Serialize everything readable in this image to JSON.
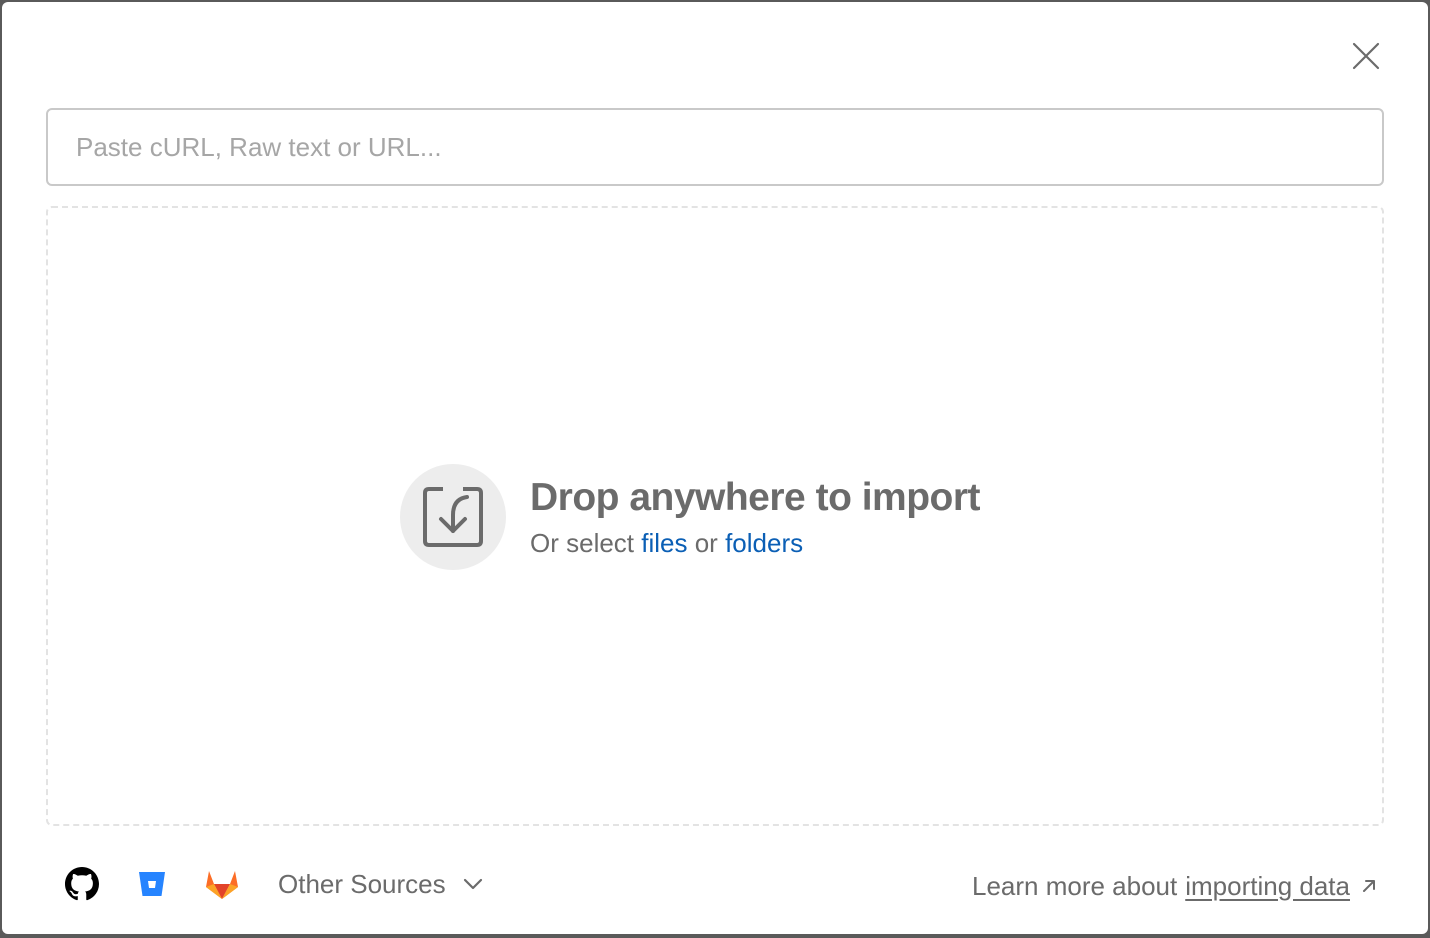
{
  "dialog": {
    "close_label": "Close"
  },
  "url_input": {
    "placeholder": "Paste cURL, Raw text or URL...",
    "value": ""
  },
  "dropzone": {
    "title": "Drop anywhere to import",
    "subtitle_prefix": "Or select ",
    "files_link": "files",
    "middle": " or ",
    "folders_link": "folders",
    "icon": "import-icon"
  },
  "sources": {
    "icons": [
      "github-icon",
      "bitbucket-icon",
      "gitlab-icon"
    ],
    "colors": {
      "github": "#000000",
      "bitbucket": "#2684ff",
      "gitlab": "#fc6d26"
    },
    "other_label": "Other Sources"
  },
  "learn_more": {
    "prefix": "Learn more about",
    "link": "importing data"
  },
  "colors": {
    "link": "#0b5fb5",
    "text_muted": "#6b6b6b",
    "border": "#c9c9c9"
  }
}
